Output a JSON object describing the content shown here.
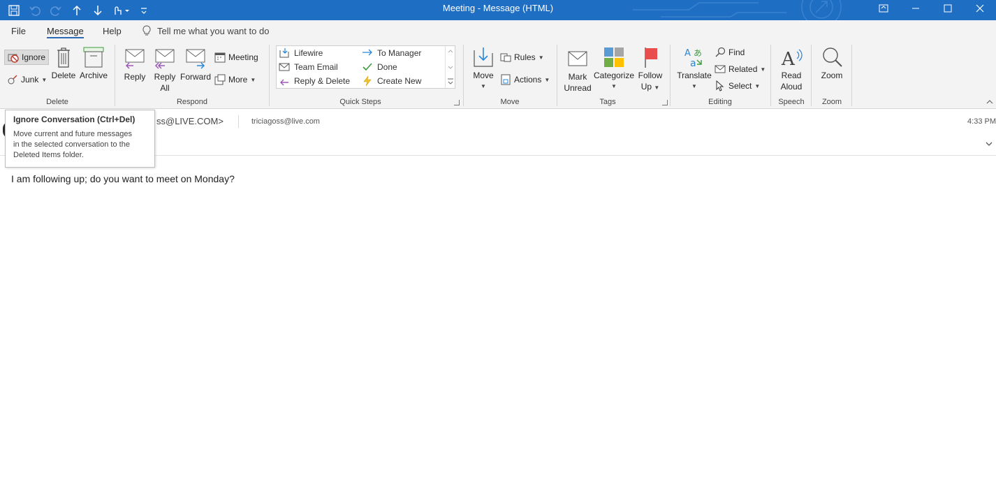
{
  "window": {
    "title": "Meeting  -  Message (HTML)"
  },
  "menu": {
    "tabs": [
      "File",
      "Message",
      "Help"
    ],
    "active_tab": "Message",
    "tell_me": "Tell me what you want to do"
  },
  "ribbon": {
    "delete_group": {
      "label": "Delete",
      "ignore": "Ignore",
      "junk": "Junk",
      "delete": "Delete",
      "archive": "Archive"
    },
    "respond_group": {
      "label": "Respond",
      "reply": "Reply",
      "reply_all_1": "Reply",
      "reply_all_2": "All",
      "forward": "Forward",
      "meeting": "Meeting",
      "more": "More"
    },
    "quick_steps_group": {
      "label": "Quick Steps",
      "items": [
        "Lifewire",
        "To Manager",
        "Team Email",
        "Done",
        "Reply & Delete",
        "Create New"
      ]
    },
    "move_group": {
      "label": "Move",
      "move": "Move",
      "rules": "Rules",
      "actions": "Actions"
    },
    "tags_group": {
      "label": "Tags",
      "mark_unread_1": "Mark",
      "mark_unread_2": "Unread",
      "categorize": "Categorize",
      "follow_up_1": "Follow",
      "follow_up_2": "Up"
    },
    "editing_group": {
      "label": "Editing",
      "translate": "Translate",
      "find": "Find",
      "related": "Related",
      "select": "Select"
    },
    "speech_group": {
      "label": "Speech",
      "read_aloud_1": "Read",
      "read_aloud_2": "Aloud"
    },
    "zoom_group": {
      "label": "Zoom",
      "zoom": "Zoom"
    }
  },
  "message": {
    "from_partial": "ss@LIVE.COM>",
    "to": "triciagoss@live.com",
    "time": "4:33 PM",
    "body": "I am following up; do you want to meet on Monday?"
  },
  "tooltip": {
    "title": "Ignore Conversation (Ctrl+Del)",
    "description_lines": [
      "Move current and future messages",
      "in the selected conversation to the",
      "Deleted Items folder."
    ]
  },
  "colors": {
    "titlebar": "#1e6ec4",
    "accent": "#2b6bb5",
    "ribbon_bg": "#f3f3f3"
  }
}
